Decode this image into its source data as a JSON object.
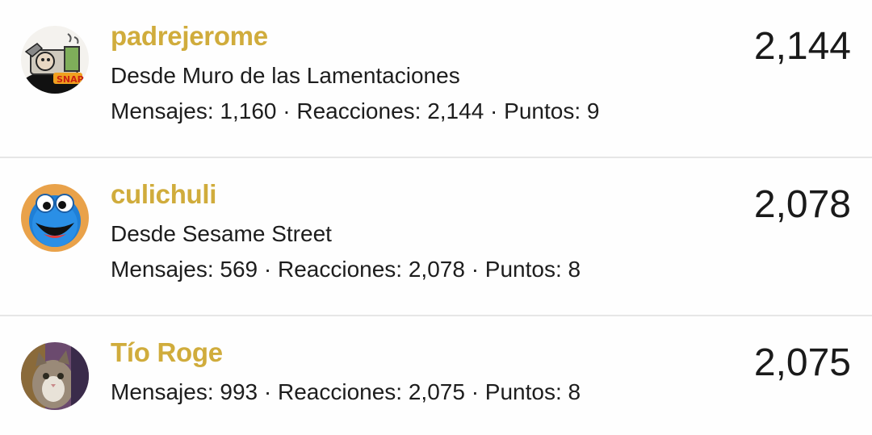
{
  "members": [
    {
      "username": "padrejerome",
      "location": "Desde Muro de las Lamentaciones",
      "stats": "Mensajes: 1,160 · Reacciones: 2,144 · Puntos: 9",
      "score": "2,144",
      "avatar_icon": "snap-cartoon-avatar"
    },
    {
      "username": "culichuli",
      "location": "Desde Sesame Street",
      "stats": "Mensajes: 569 · Reacciones: 2,078 · Puntos: 8",
      "score": "2,078",
      "avatar_icon": "cookie-monster-avatar"
    },
    {
      "username": "Tío Roge",
      "stats": "Mensajes: 993 · Reacciones: 2,075 · Puntos: 8",
      "score": "2,075",
      "avatar_icon": "cat-photo-avatar"
    }
  ],
  "colors": {
    "username": "#d0ac3c",
    "text": "#1d1d1d",
    "divider": "#e6e6e6"
  }
}
